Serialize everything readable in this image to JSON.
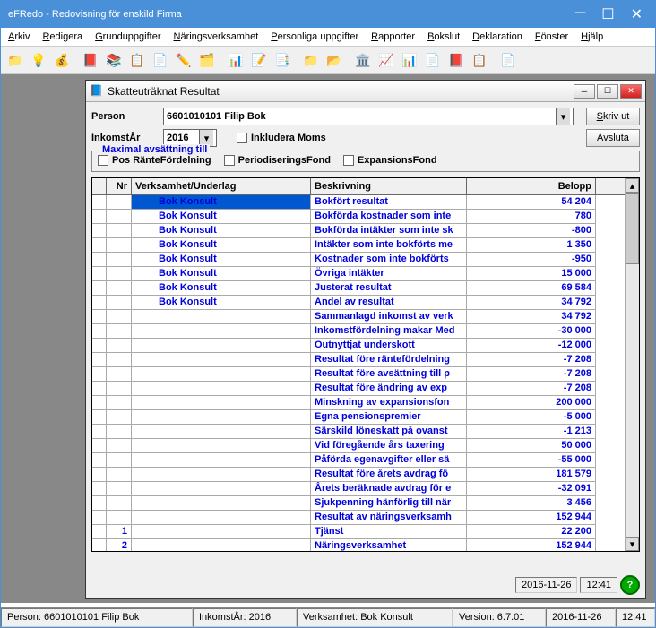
{
  "title": "eFRedo - Redovisning för enskild Firma",
  "menu": [
    "Arkiv",
    "Redigera",
    "Grunduppgifter",
    "Näringsverksamhet",
    "Personliga uppgifter",
    "Rapporter",
    "Bokslut",
    "Deklaration",
    "Fönster",
    "Hjälp"
  ],
  "child": {
    "title": "Skatteuträknat Resultat",
    "person_label": "Person",
    "person_value": "6601010101     Filip Bok",
    "year_label": "InkomstÅr",
    "year_value": "2016",
    "moms_label": "Inkludera Moms",
    "btn_print": "Skriv ut",
    "btn_close": "Avsluta",
    "fieldset_legend": "Maximal avsättning till",
    "chk_rantef": "Pos RänteFördelning",
    "chk_period": "PeriodiseringsFond",
    "chk_expan": "ExpansionsFond",
    "headers": {
      "nr": "Nr",
      "verk": "Verksamhet/Underlag",
      "besk": "Beskrivning",
      "bel": "Belopp"
    },
    "rows": [
      {
        "nr": "",
        "verk": "Bok Konsult",
        "besk": "Bokfört resultat",
        "bel": "54 204"
      },
      {
        "nr": "",
        "verk": "Bok Konsult",
        "besk": "Bokförda kostnader som inte",
        "bel": "780"
      },
      {
        "nr": "",
        "verk": "Bok Konsult",
        "besk": "Bokförda intäkter som inte sk",
        "bel": "-800"
      },
      {
        "nr": "",
        "verk": "Bok Konsult",
        "besk": "Intäkter som inte bokförts me",
        "bel": "1 350"
      },
      {
        "nr": "",
        "verk": "Bok Konsult",
        "besk": "Kostnader som inte bokförts",
        "bel": "-950"
      },
      {
        "nr": "",
        "verk": "Bok Konsult",
        "besk": "Övriga intäkter",
        "bel": "15 000"
      },
      {
        "nr": "",
        "verk": "Bok Konsult",
        "besk": "Justerat resultat",
        "bel": "69 584"
      },
      {
        "nr": "",
        "verk": "Bok Konsult",
        "besk": "Andel av resultat",
        "bel": "34 792"
      },
      {
        "nr": "",
        "verk": "",
        "besk": "Sammanlagd inkomst av verk",
        "bel": "34 792"
      },
      {
        "nr": "",
        "verk": "",
        "besk": "Inkomstfördelning makar Med",
        "bel": "-30 000"
      },
      {
        "nr": "",
        "verk": "",
        "besk": "Outnyttjat underskott",
        "bel": "-12 000"
      },
      {
        "nr": "",
        "verk": "",
        "besk": "Resultat före räntefördelning",
        "bel": "-7 208"
      },
      {
        "nr": "",
        "verk": "",
        "besk": "Resultat före avsättning till p",
        "bel": "-7 208"
      },
      {
        "nr": "",
        "verk": "",
        "besk": "Resultat före ändring av exp",
        "bel": "-7 208"
      },
      {
        "nr": "",
        "verk": "",
        "besk": "Minskning av expansionsfon",
        "bel": "200 000"
      },
      {
        "nr": "",
        "verk": "",
        "besk": "Egna pensionspremier",
        "bel": "-5 000"
      },
      {
        "nr": "",
        "verk": "",
        "besk": "Särskild löneskatt på ovanst",
        "bel": "-1 213"
      },
      {
        "nr": "",
        "verk": "",
        "besk": "Vid föregående års taxering",
        "bel": "50 000"
      },
      {
        "nr": "",
        "verk": "",
        "besk": "Påförda egenavgifter eller sä",
        "bel": "-55 000"
      },
      {
        "nr": "",
        "verk": "",
        "besk": "Resultat före årets avdrag fö",
        "bel": "181 579"
      },
      {
        "nr": "",
        "verk": "",
        "besk": "Årets beräknade avdrag för e",
        "bel": "-32 091"
      },
      {
        "nr": "",
        "verk": "",
        "besk": "Sjukpenning hänförlig till när",
        "bel": "3 456"
      },
      {
        "nr": "",
        "verk": "",
        "besk": "Resultat av näringsverksamh",
        "bel": "152 944"
      },
      {
        "nr": "1",
        "verk": "",
        "besk": "Tjänst",
        "bel": "22 200"
      },
      {
        "nr": "2",
        "verk": "",
        "besk": "Näringsverksamhet",
        "bel": "152 944"
      }
    ],
    "status_date": "2016-11-26",
    "status_time": "12:41"
  },
  "status": {
    "person": "Person: 6601010101  Filip Bok",
    "year": "InkomstÅr: 2016",
    "verk": "Verksamhet: Bok Konsult",
    "ver": "Version: 6.7.01",
    "date": "2016-11-26",
    "time": "12:41"
  }
}
